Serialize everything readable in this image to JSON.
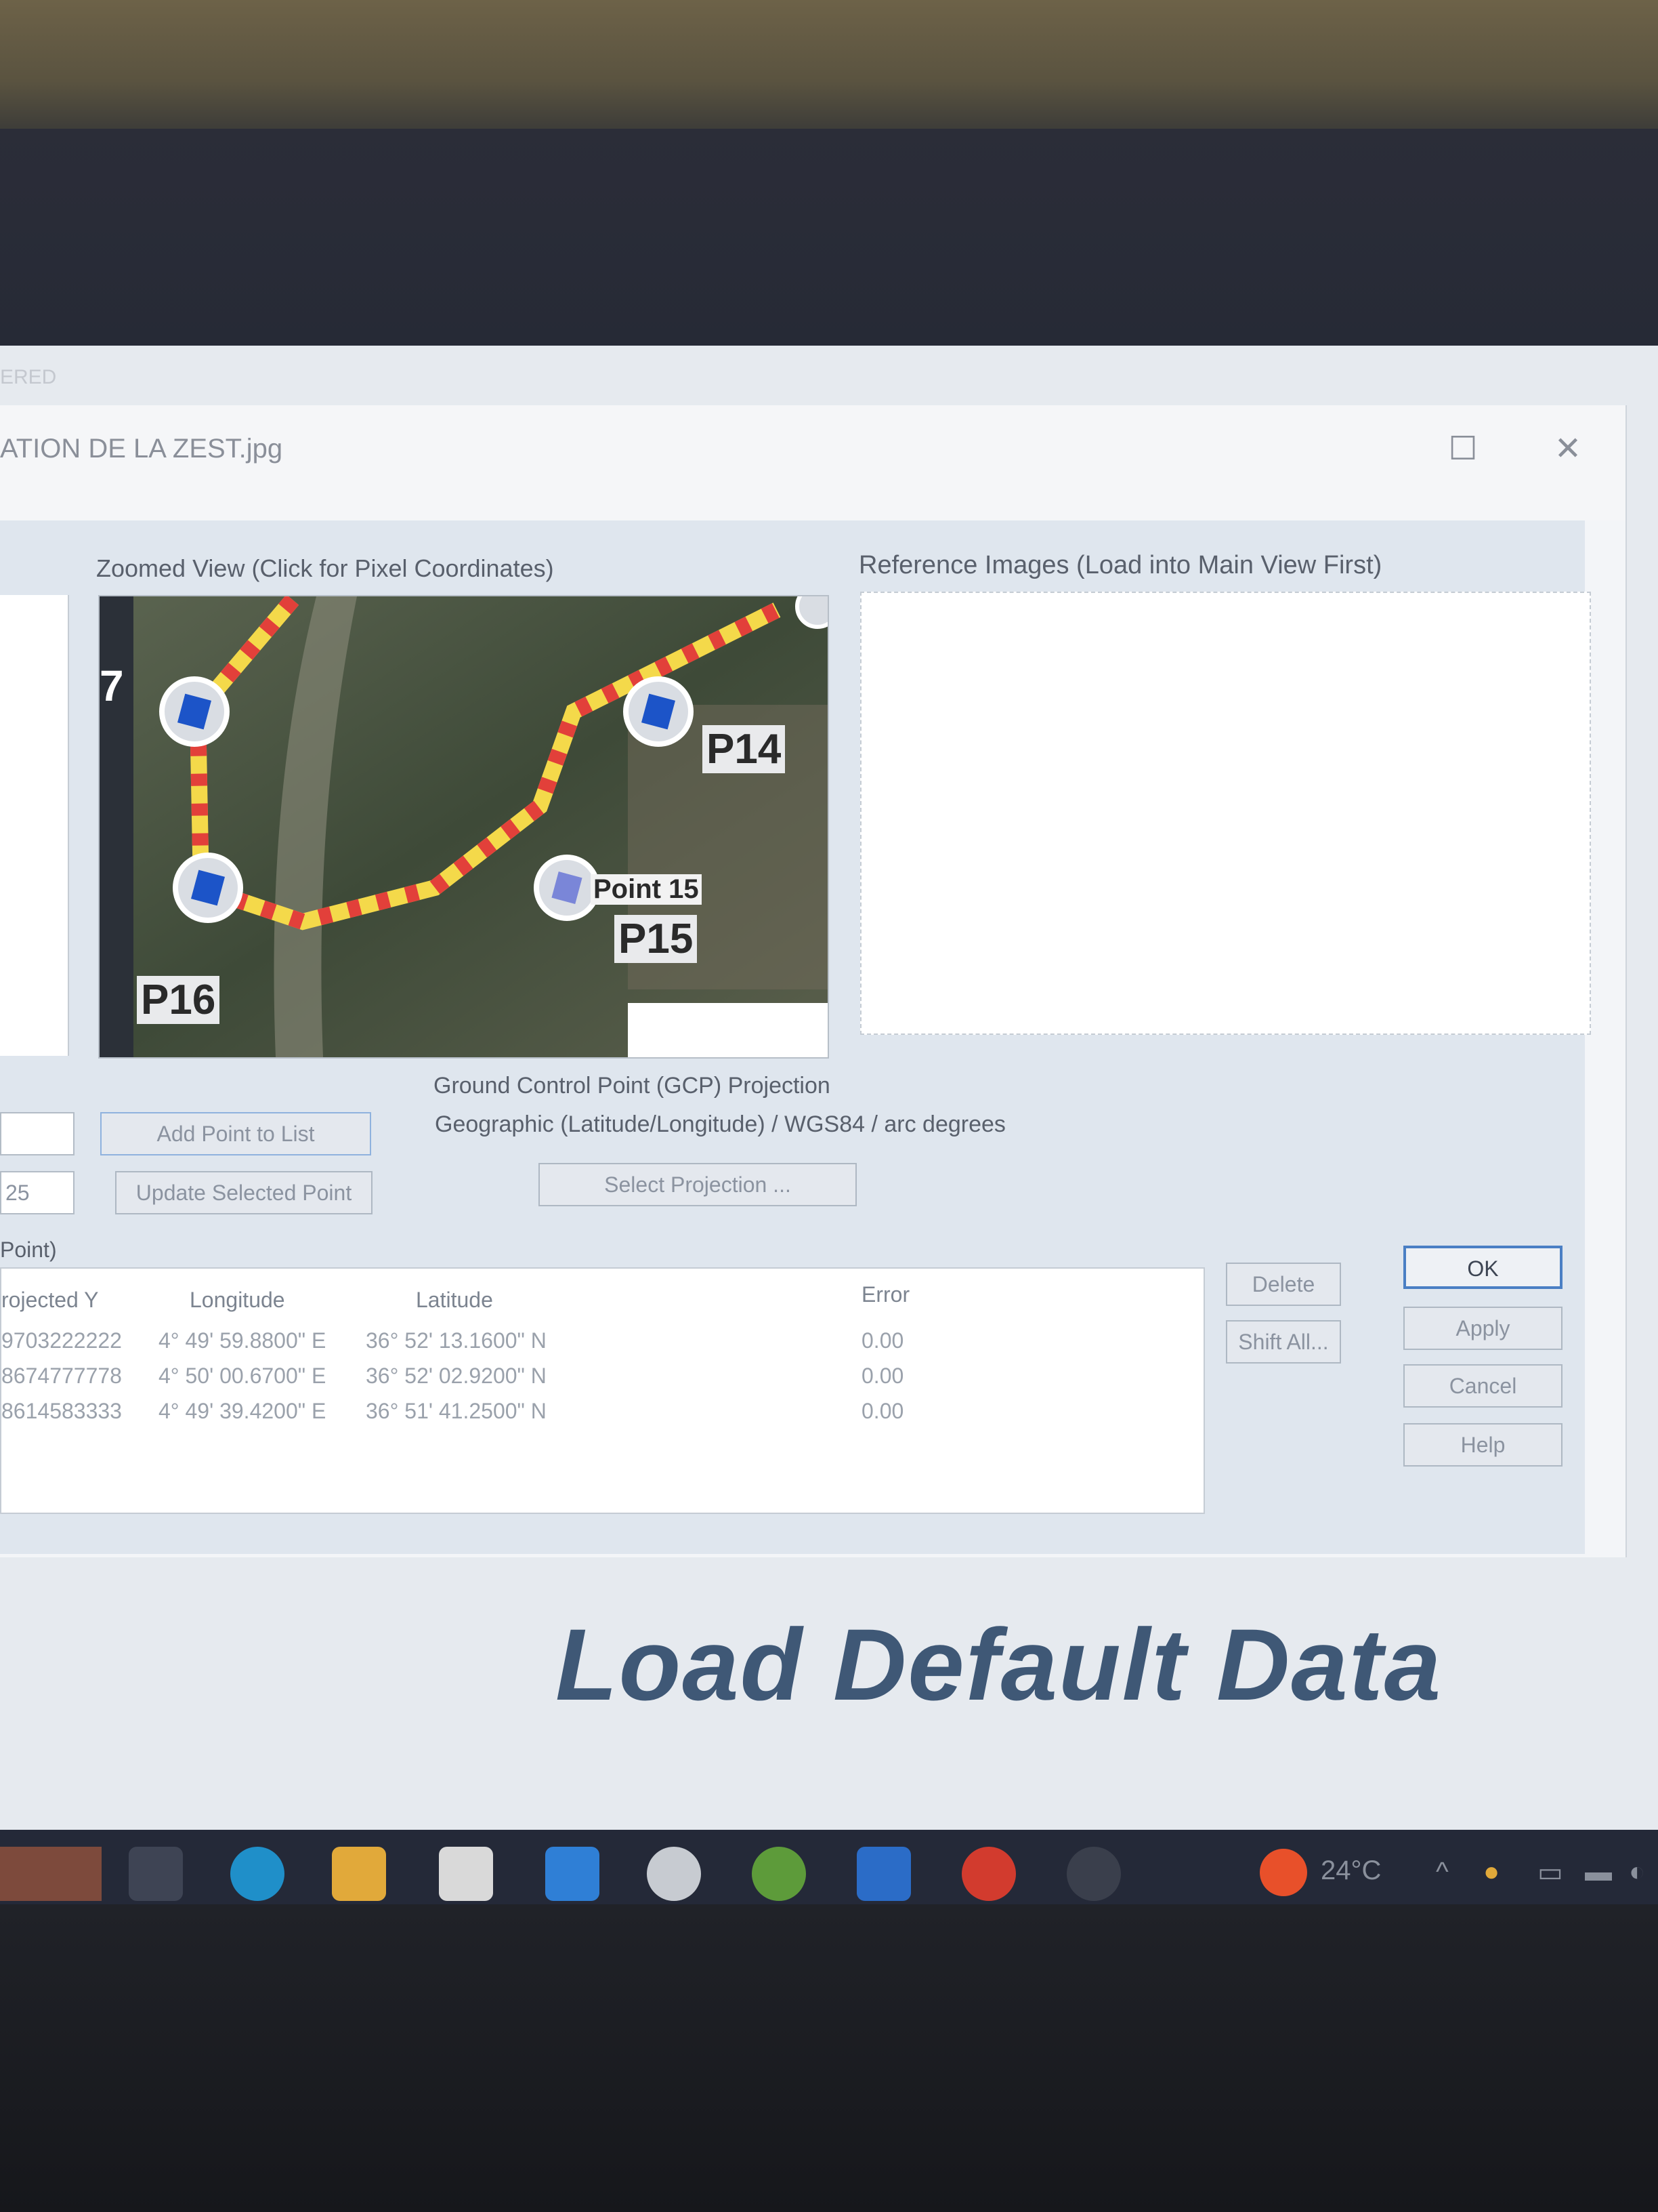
{
  "parent_window": {
    "title_fragment": "ERED"
  },
  "window": {
    "title": "ATION DE LA ZEST.jpg",
    "controls": {
      "maximize": "☐",
      "close": "✕"
    }
  },
  "zoom_view": {
    "label": "Zoomed View (Click for Pixel Coordinates)",
    "markers": {
      "left_edge": "7",
      "p14": "P14",
      "p15": "P15",
      "p16": "P16",
      "point15_callout": "Point 15"
    }
  },
  "reference_images": {
    "label": "Reference Images (Load into Main View First)"
  },
  "inputs": {
    "field1_value": "",
    "field2_value": "25"
  },
  "buttons": {
    "add_point": "Add Point to List",
    "update_point": "Update Selected Point",
    "select_projection": "Select Projection ...",
    "delete": "Delete",
    "shift_all": "Shift All...",
    "ok": "OK",
    "apply": "Apply",
    "cancel": "Cancel",
    "help": "Help"
  },
  "projection": {
    "label": "Ground Control Point (GCP) Projection",
    "value": "Geographic (Latitude/Longitude) / WGS84 / arc degrees"
  },
  "gcp_list": {
    "section_label": "Point)",
    "columns": [
      "rojected Y",
      "Longitude",
      "Latitude",
      "Error"
    ],
    "rows": [
      [
        "9703222222",
        "4° 49' 59.8800\" E",
        "36° 52' 13.1600\" N",
        "0.00"
      ],
      [
        "8674777778",
        "4° 50' 00.6700\" E",
        "36° 52' 02.9200\" N",
        "0.00"
      ],
      [
        "8614583333",
        "4° 49' 39.4200\" E",
        "36° 51' 41.2500\" N",
        "0.00"
      ]
    ]
  },
  "banner": {
    "text": "Load Default Data"
  },
  "taskbar": {
    "icons": [
      "widgets-icon",
      "task-view-icon",
      "edge-icon",
      "file-explorer-icon",
      "store-icon",
      "mail-icon",
      "globe-app-icon",
      "qgis-icon",
      "app-icon",
      "chrome-icon",
      "app-icon-faded"
    ],
    "temperature": "24°C",
    "colors": {
      "weather": "#e8502a"
    }
  }
}
